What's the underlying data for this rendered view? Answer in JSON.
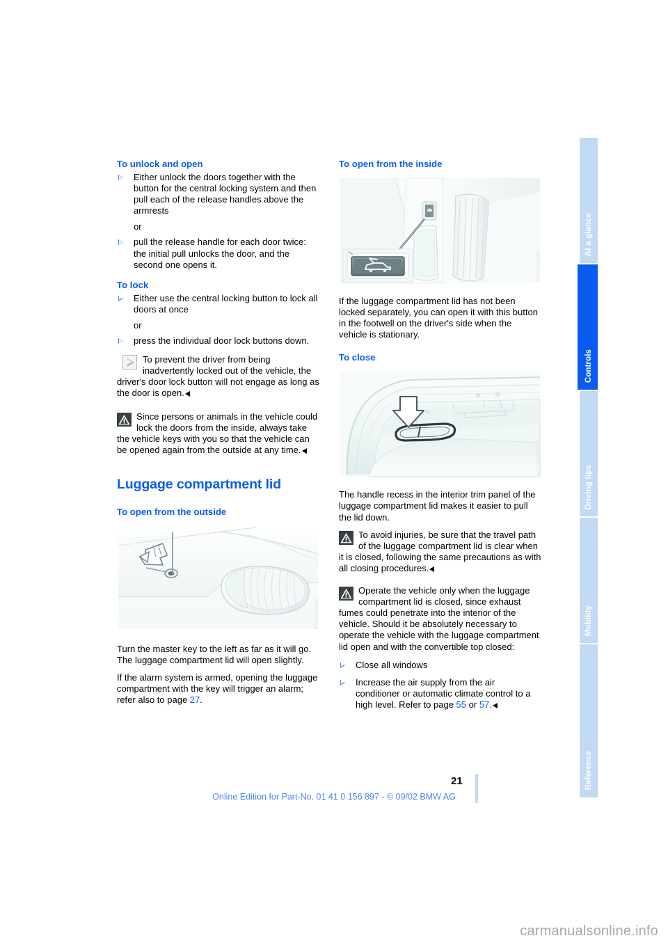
{
  "document": {
    "page_number": "21",
    "footer_line": "Online Edition for Part-No. 01 41 0 156 897 - © 09/02 BMW AG",
    "watermark": "carmanualsonline.info"
  },
  "tabs": [
    {
      "label": "At a glance",
      "active": false
    },
    {
      "label": "Controls",
      "active": true
    },
    {
      "label": "Driving tips",
      "active": false
    },
    {
      "label": "Mobility",
      "active": false
    },
    {
      "label": "Reference",
      "active": false
    }
  ],
  "left_column": {
    "heading_unlock": "To unlock and open",
    "unlock_bullet_1": "Either unlock the doors together with the button for the central locking system and then pull each of the release handles above the armrests",
    "or_1": "or",
    "unlock_bullet_2": "pull the release handle for each door twice: the initial pull unlocks the door, and the second one opens it.",
    "heading_lock": "To lock",
    "lock_bullet_1": "Either use the central locking button to lock all doors at once",
    "or_2": "or",
    "lock_bullet_2": "press the individual door lock buttons down.",
    "note_text": "To prevent the driver from being inadvertently locked out of the vehicle, the driver's door lock button will not engage as long as the door is open.",
    "warning_text": "Since persons or animals in the vehicle could lock the doors from the inside, always take the vehicle keys with you so that the vehicle can be opened again from the outside at any time.",
    "heading_chapter": "Luggage compartment lid",
    "heading_open_outside": "To open from the outside",
    "figure_outside_caption": "Rear of vehicle showing master key turned in the luggage compartment lock",
    "figure_outside_watermark": "VAR01-0104",
    "body_1": "Turn the master key to the left as far as it will go. The luggage compartment lid will open slightly.",
    "body_2_part1": "If the alarm system is armed, opening the luggage compartment with the key will trigger an alarm; refer also to page ",
    "body_2_page_ref": "27",
    "body_2_part2": "."
  },
  "right_column": {
    "heading_open_inside": "To open from the inside",
    "figure_inside_caption": "Luggage compartment release button in the driver's side footwell with detail inset",
    "figure_inside_watermark": "VAR01-0105",
    "body_inside": "If the luggage compartment lid has not been locked separately, you can open it with this button in the footwell on the driver's side when the vehicle is stationary.",
    "heading_close": "To close",
    "figure_close_caption": "Interior trim panel of the luggage compartment lid with handle recess and downward arrow",
    "figure_close_watermark": "VAR01-0106",
    "body_close": "The handle recess in the interior trim panel of the luggage compartment lid makes it easier to pull the lid down.",
    "warning_1": "To avoid injuries, be sure that the travel path of the luggage compartment lid is clear when it is closed, following the same precautions as with all closing procedures.",
    "warning_2": "Operate the vehicle only when the luggage compartment lid is closed, since exhaust fumes could penetrate into the interior of the vehicle. Should it be absolutely necessary to operate the vehicle with the luggage compartment lid open and with the convertible top closed:",
    "bullet_close_windows": "Close all windows",
    "bullet_air_supply_part1": "Increase the air supply from the air conditioner or automatic climate control to a high level. Refer to page ",
    "bullet_air_ref_1": "55",
    "bullet_air_or": " or ",
    "bullet_air_ref_2": "57",
    "bullet_air_supply_part2": "."
  },
  "colors": {
    "accent_blue": "#0a5cf0",
    "tab_inactive": "#c2d9f4",
    "footer_blue": "#4d86f7",
    "warning_icon_bg": "#3a4145"
  }
}
